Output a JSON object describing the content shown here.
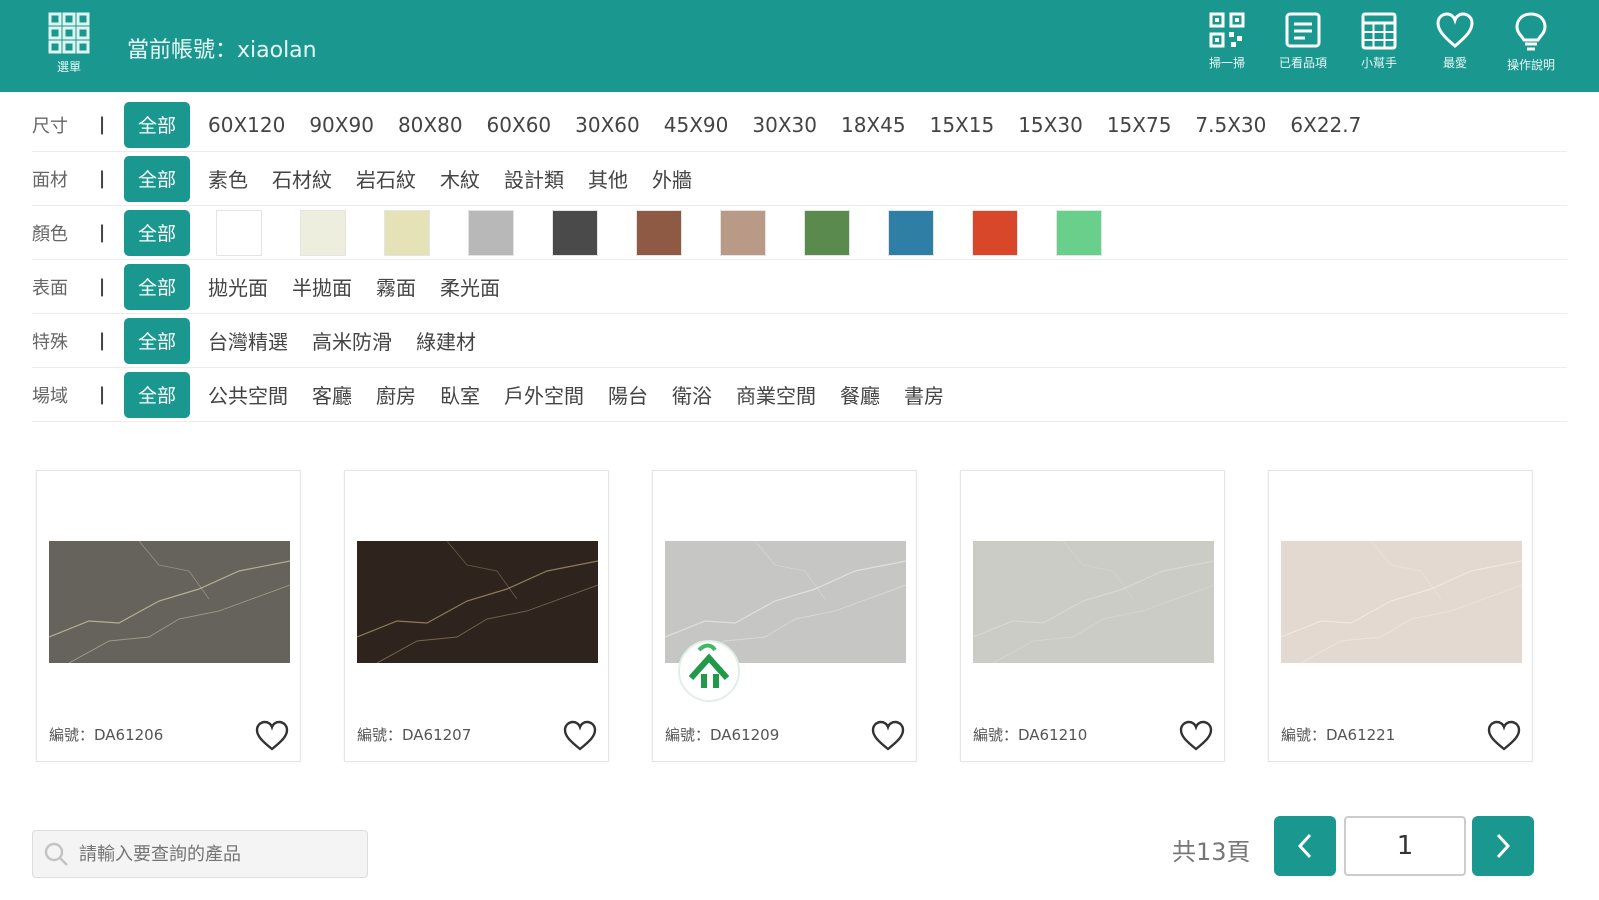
{
  "header": {
    "menu_label": "選單",
    "account_text": "當前帳號：xiaolan",
    "tools": [
      {
        "icon": "qr-code-icon",
        "label": "掃一掃"
      },
      {
        "icon": "list-icon",
        "label": "已看品項"
      },
      {
        "icon": "calculator-icon",
        "label": "小幫手"
      },
      {
        "icon": "heart-icon",
        "label": "最愛"
      },
      {
        "icon": "lightbulb-icon",
        "label": "操作說明"
      }
    ],
    "colors": {
      "brand": "#1a9890"
    }
  },
  "filters": [
    {
      "label": "尺寸",
      "separator": "|",
      "all": "全部",
      "options": [
        "60X120",
        "90X90",
        "80X80",
        "60X60",
        "30X60",
        "45X90",
        "30X30",
        "18X45",
        "15X15",
        "15X30",
        "15X75",
        "7.5X30",
        "6X22.7"
      ]
    },
    {
      "label": "面材",
      "separator": "|",
      "all": "全部",
      "options": [
        "素色",
        "石材紋",
        "岩石紋",
        "木紋",
        "設計類",
        "其他",
        "外牆"
      ]
    },
    {
      "label": "顏色",
      "separator": "|",
      "all": "全部",
      "swatches": [
        "#ffffff",
        "#eeeede",
        "#e6e2b8",
        "#b8b8b8",
        "#4a4a4a",
        "#8e5a44",
        "#b89a86",
        "#5a8a4e",
        "#2f7ea6",
        "#d9472a",
        "#69d08c"
      ]
    },
    {
      "label": "表面",
      "separator": "|",
      "all": "全部",
      "options": [
        "拋光面",
        "半拋面",
        "霧面",
        "柔光面"
      ]
    },
    {
      "label": "特殊",
      "separator": "|",
      "all": "全部",
      "options": [
        "台灣精選",
        "高米防滑",
        "綠建材"
      ]
    },
    {
      "label": "場域",
      "separator": "|",
      "all": "全部",
      "options": [
        "公共空間",
        "客廳",
        "廚房",
        "臥室",
        "戶外空間",
        "陽台",
        "衛浴",
        "商業空間",
        "餐廳",
        "書房"
      ]
    }
  ],
  "products": [
    {
      "code": "編號：DA61206",
      "tile_color": "#65635b",
      "vein_color": "#c9c2a8"
    },
    {
      "code": "編號：DA61207",
      "tile_color": "#2e241d",
      "vein_color": "#a8906e"
    },
    {
      "code": "編號：DA61209",
      "tile_color": "#c6c6c4",
      "vein_color": "#e6e6e4",
      "has_badge": true
    },
    {
      "code": "編號：DA61210",
      "tile_color": "#cbccc6",
      "vein_color": "#dcdcd6"
    },
    {
      "code": "編號：DA61221",
      "tile_color": "#e4d9d0",
      "vein_color": "#f2ebe4"
    }
  ],
  "search": {
    "placeholder": "請輸入要查詢的產品"
  },
  "pagination": {
    "total_text": "共13頁",
    "current_page": "1"
  }
}
